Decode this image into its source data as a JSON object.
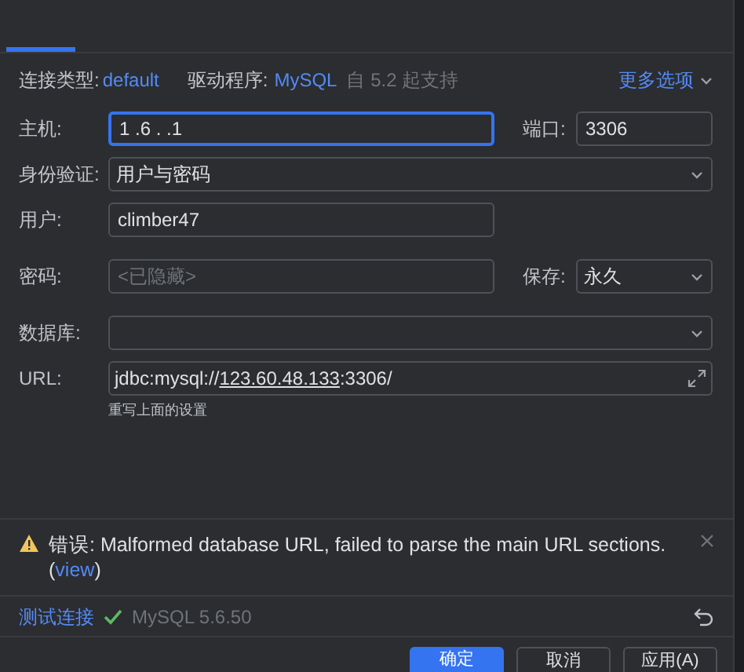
{
  "tab_strip": {
    "tabs": [
      {
        "selected": true
      }
    ]
  },
  "info": {
    "type_label": "连接类型:",
    "type_value": "default",
    "driver_label": "驱动程序:",
    "driver_value": "MySQL",
    "driver_note": "自 5.2 起支持",
    "more_options": "更多选项"
  },
  "fields": [
    {
      "kind": "text",
      "label": "主机:",
      "value": "1 .6 . .1",
      "focused": true,
      "wide": false,
      "side": {
        "kind": "text",
        "label": "端口:",
        "value": "3306"
      }
    },
    {
      "kind": "select",
      "label": "身份验证:",
      "value": "用户与密码",
      "wide": true
    },
    {
      "kind": "text",
      "label": "用户:",
      "value": "climber47",
      "focused": false,
      "wide": false
    },
    {
      "kind": "text",
      "label": "密码:",
      "placeholder": "<已隐藏>",
      "focused": false,
      "wide": false,
      "side": {
        "kind": "select",
        "label": "保存:",
        "value": "永久"
      }
    },
    {
      "kind": "select",
      "label": "数据库:",
      "wide": true
    },
    {
      "kind": "url",
      "label": "URL:",
      "prefix": "jdbc:mysql://",
      "link": "123.60.48.133",
      "suffix": ":3306/",
      "hint": "重写上面的设置",
      "wide": true
    }
  ],
  "error": {
    "label": "错误:",
    "message": "Malformed database URL, failed to parse the main URL sections.",
    "open_paren": "(",
    "link": "view",
    "close_paren": ")"
  },
  "test": {
    "link": "测试连接",
    "ok": true,
    "result": "MySQL 5.6.50"
  },
  "buttons": [
    {
      "label": "确定",
      "primary": true
    },
    {
      "label": "取消",
      "primary": false
    },
    {
      "label": "应用(A)",
      "primary": false
    }
  ]
}
